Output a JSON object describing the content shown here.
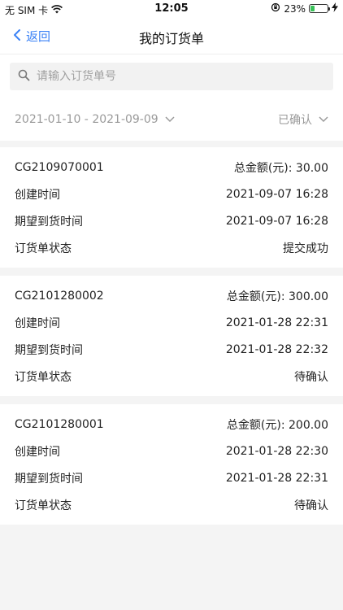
{
  "status_bar": {
    "carrier": "无 SIM 卡",
    "time": "12:05",
    "battery_percent": "23%",
    "battery_level": 0.23
  },
  "nav": {
    "back_label": "返回",
    "title": "我的订货单"
  },
  "search": {
    "placeholder": "请输入订货单号",
    "value": ""
  },
  "filters": {
    "date_range": "2021-01-10 - 2021-09-09",
    "status": "已确认"
  },
  "labels": {
    "created_time": "创建时间",
    "expected_time": "期望到货时间",
    "order_status": "订货单状态"
  },
  "orders": [
    {
      "id": "CG2109070001",
      "total": "总金额(元): 30.00",
      "created": "2021-09-07 16:28",
      "expected": "2021-09-07 16:28",
      "status": "提交成功"
    },
    {
      "id": "CG2101280002",
      "total": "总金额(元): 300.00",
      "created": "2021-01-28 22:31",
      "expected": "2021-01-28 22:32",
      "status": "待确认"
    },
    {
      "id": "CG2101280001",
      "total": "总金额(元): 200.00",
      "created": "2021-01-28 22:30",
      "expected": "2021-01-28 22:31",
      "status": "待确认"
    }
  ],
  "colors": {
    "accent": "#3b82f6",
    "battery": "#3ac35a",
    "background": "#f4f4f4"
  }
}
